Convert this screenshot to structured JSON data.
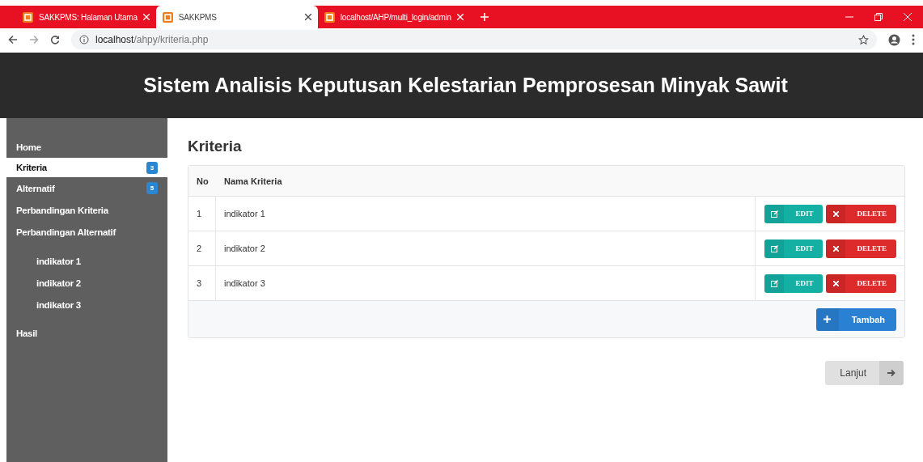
{
  "browser": {
    "tabs": [
      {
        "title": "SAKKPMS: Halaman Utama",
        "selected": false
      },
      {
        "title": "SAKKPMS",
        "selected": true
      },
      {
        "title": "localhost/AHP/multi_login/admin",
        "selected": false
      }
    ],
    "url": {
      "host": "localhost",
      "path": "/ahpy/kriteria.php"
    }
  },
  "header": {
    "title": "Sistem Analisis Keputusan Kelestarian Pemprosesan Minyak Sawit"
  },
  "sidebar": {
    "items": [
      {
        "label": "Home",
        "selected": false
      },
      {
        "label": "Kriteria",
        "selected": true,
        "badge": "3"
      },
      {
        "label": "Alternatif",
        "selected": false,
        "badge": "5"
      },
      {
        "label": "Perbandingan Kriteria",
        "selected": false
      },
      {
        "label": "Perbandingan Alternatif",
        "selected": false,
        "children": [
          {
            "label": "indikator 1",
            "selected": false
          },
          {
            "label": "indikator 2",
            "selected": false
          },
          {
            "label": "indikator 3",
            "selected": false
          }
        ]
      },
      {
        "label": "Hasil",
        "selected": false
      }
    ]
  },
  "content": {
    "title": "Kriteria",
    "table": {
      "columns": [
        "No",
        "Nama Kriteria"
      ],
      "rows": [
        {
          "no": "1",
          "name": "indikator 1",
          "edit": "EDIT",
          "delete": "DELETE"
        },
        {
          "no": "2",
          "name": "indikator 2",
          "edit": "EDIT",
          "delete": "DELETE"
        },
        {
          "no": "3",
          "name": "indikator 3",
          "edit": "EDIT",
          "delete": "DELETE"
        }
      ]
    },
    "add_button": "Tambah",
    "next_button": "Lanjut"
  }
}
